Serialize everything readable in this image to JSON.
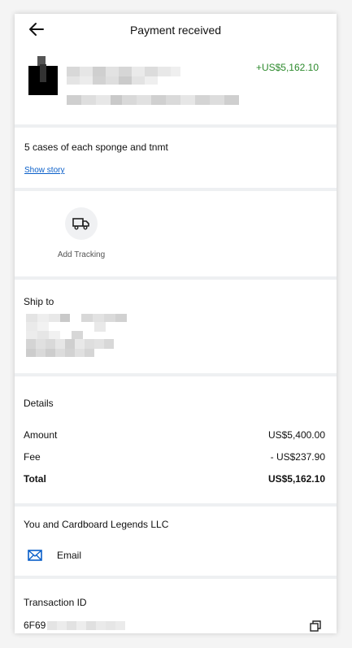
{
  "header": {
    "title": "Payment received"
  },
  "payment": {
    "amount": "+US$5,162.10"
  },
  "note": {
    "text": "5 cases of each sponge and tnmt",
    "show_story": "Show story"
  },
  "tracking": {
    "label": "Add Tracking"
  },
  "ship": {
    "label": "Ship to"
  },
  "details": {
    "title": "Details",
    "rows": [
      {
        "label": "Amount",
        "value": "US$5,400.00"
      },
      {
        "label": "Fee",
        "value": "- US$237.90"
      },
      {
        "label": "Total",
        "value": "US$5,162.10"
      }
    ]
  },
  "party": {
    "title": "You and Cardboard Legends LLC",
    "email_label": "Email"
  },
  "transaction": {
    "title": "Transaction ID",
    "id_prefix": "6F69"
  },
  "colors": {
    "accent": "#0a5fc9",
    "positive": "#2c8a2c"
  },
  "icons": [
    "back-arrow-icon",
    "truck-icon",
    "mail-icon",
    "copy-icon"
  ]
}
